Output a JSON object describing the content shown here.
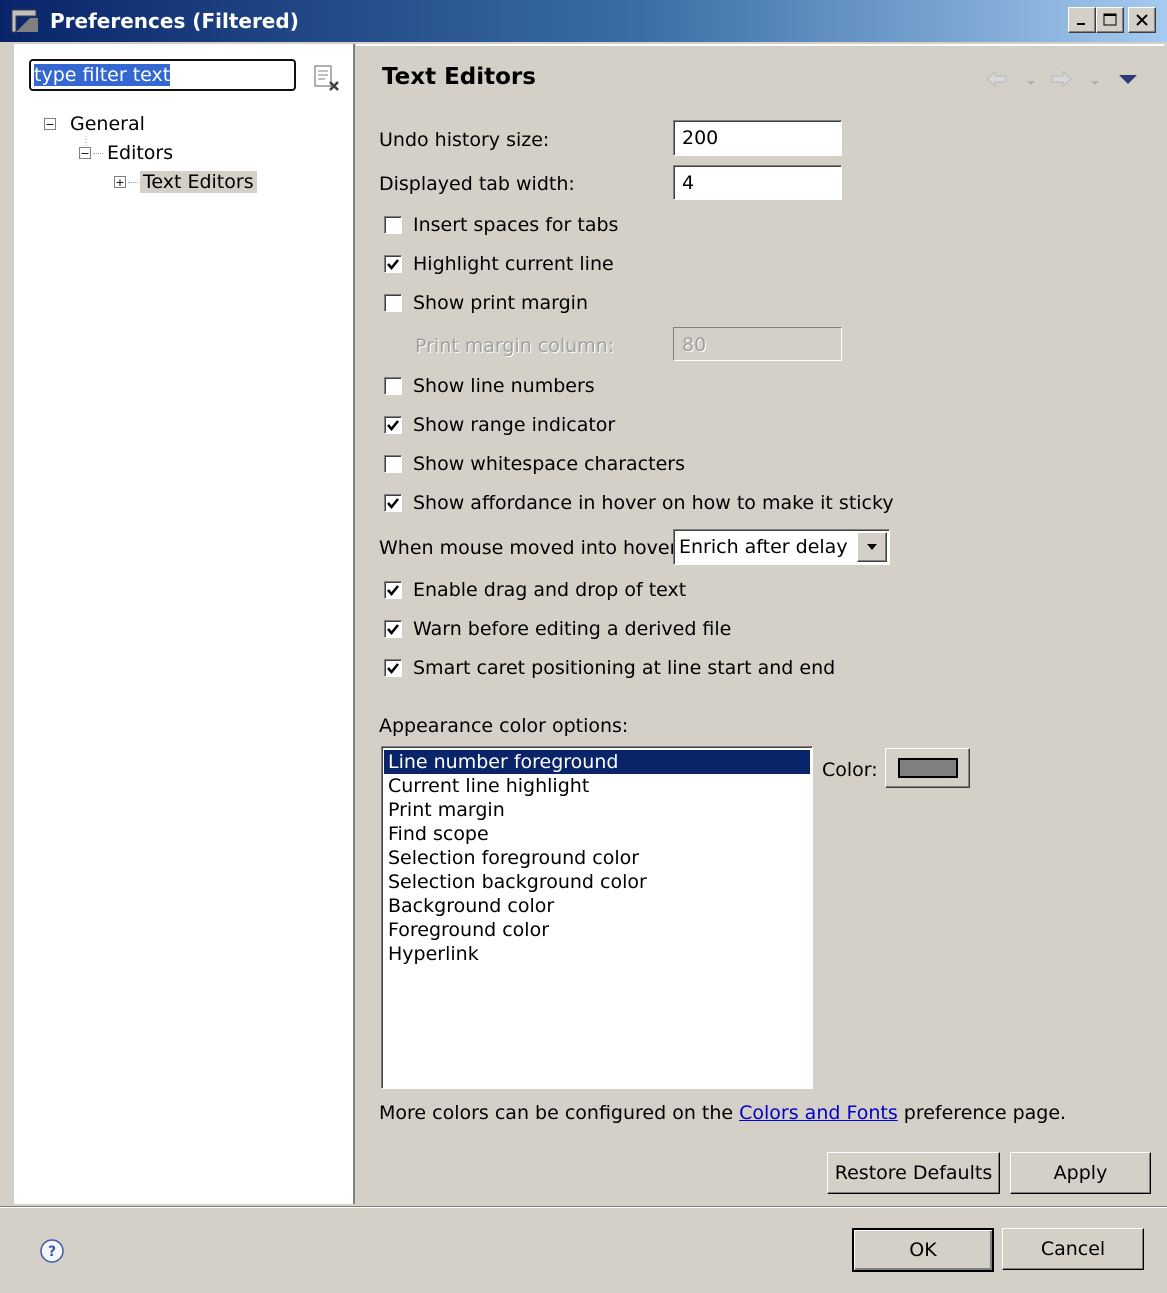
{
  "window": {
    "title": "Preferences (Filtered)"
  },
  "filter": {
    "value": "type filter text"
  },
  "tree": {
    "items": [
      {
        "label": "General",
        "expander": "−"
      },
      {
        "label": "Editors",
        "expander": "−"
      },
      {
        "label": "Text Editors",
        "expander": "+"
      }
    ]
  },
  "page": {
    "title": "Text Editors",
    "undo_label": "Undo history size:",
    "undo_value": "200",
    "tab_label": "Displayed tab width:",
    "tab_value": "4",
    "options": {
      "insert_spaces": {
        "label": "Insert spaces for tabs",
        "checked": false
      },
      "highlight_line": {
        "label": "Highlight current line",
        "checked": true
      },
      "print_margin": {
        "label": "Show print margin",
        "checked": false
      },
      "line_numbers": {
        "label": "Show line numbers",
        "checked": false
      },
      "range_indicator": {
        "label": "Show range indicator",
        "checked": true
      },
      "whitespace": {
        "label": "Show whitespace characters",
        "checked": false
      },
      "affordance": {
        "label": "Show affordance in hover on how to make it sticky",
        "checked": true
      },
      "drag_drop": {
        "label": "Enable drag and drop of text",
        "checked": true
      },
      "warn_derived": {
        "label": "Warn before editing a derived file",
        "checked": true
      },
      "smart_caret": {
        "label": "Smart caret positioning at line start and end",
        "checked": true
      }
    },
    "print_margin_col_label": "Print margin column:",
    "print_margin_col_value": "80",
    "hover_label": "When mouse moved into hover:",
    "hover_value": "Enrich after delay",
    "appearance_label": "Appearance color options:",
    "color_items": [
      "Line number foreground",
      "Current line highlight",
      "Print margin",
      "Find scope",
      "Selection foreground color",
      "Selection background color",
      "Background color",
      "Foreground color",
      "Hyperlink"
    ],
    "selected_color_index": 0,
    "color_label": "Color:",
    "color_swatch": "#808080",
    "more_prefix": "More colors can be configured on the ",
    "more_link": "Colors and Fonts",
    "more_suffix": " preference page.",
    "restore_label": "Restore Defaults",
    "apply_label": "Apply"
  },
  "footer": {
    "ok_label": "OK",
    "cancel_label": "Cancel"
  },
  "icons": {
    "app": "preferences-app-icon",
    "clear": "clear-filter-icon",
    "back": "back-arrow-icon",
    "forward": "forward-arrow-icon",
    "menu": "view-menu-icon",
    "help": "help-icon"
  }
}
